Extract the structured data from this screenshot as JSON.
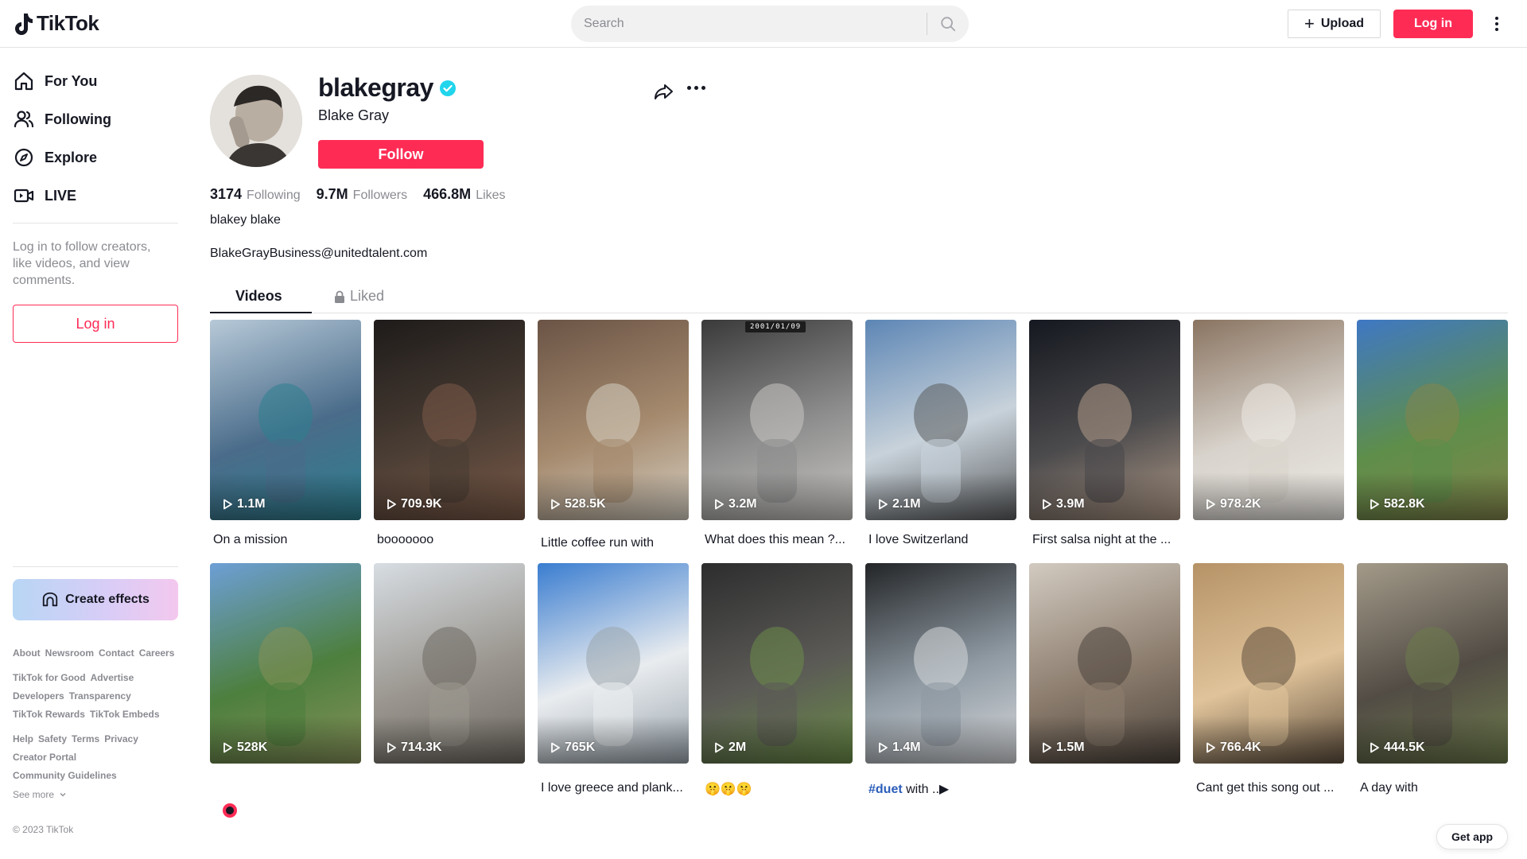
{
  "brand": {
    "name": "TikTok",
    "accent": "#fe2c55"
  },
  "header": {
    "search_placeholder": "Search",
    "upload_label": "Upload",
    "login_label": "Log in"
  },
  "sidebar": {
    "nav": [
      {
        "label": "For You",
        "icon": "home-icon"
      },
      {
        "label": "Following",
        "icon": "users-icon"
      },
      {
        "label": "Explore",
        "icon": "compass-icon"
      },
      {
        "label": "LIVE",
        "icon": "live-icon"
      }
    ],
    "note": "Log in to follow creators, like videos, and view comments.",
    "login_label": "Log in",
    "effects_label": "Create effects",
    "footer": [
      [
        "About",
        "Newsroom",
        "Contact",
        "Careers"
      ],
      [
        "TikTok for Good",
        "Advertise"
      ],
      [
        "Developers",
        "Transparency"
      ],
      [
        "TikTok Rewards",
        "TikTok Embeds"
      ],
      [
        "Help",
        "Safety",
        "Terms",
        "Privacy"
      ],
      [
        "Creator Portal"
      ],
      [
        "Community Guidelines"
      ]
    ],
    "see_more": "See more",
    "copyright": "© 2023 TikTok"
  },
  "profile": {
    "username": "blakegray",
    "display_name": "Blake Gray",
    "follow_label": "Follow",
    "stats": [
      {
        "value": "3174",
        "label": "Following"
      },
      {
        "value": "9.7M",
        "label": "Followers"
      },
      {
        "value": "466.8M",
        "label": "Likes"
      }
    ],
    "bio": "blakey blake",
    "email": "BlakeGrayBusiness@unitedtalent.com"
  },
  "tabs": {
    "videos": "Videos",
    "liked": "Liked"
  },
  "videos": [
    {
      "views": "1.1M",
      "caption": "On a mission",
      "colors": [
        "#b7c9d8",
        "#4a6c8a",
        "#2d7f8f"
      ]
    },
    {
      "views": "709.9K",
      "caption": "booooooo",
      "colors": [
        "#1e1b1a",
        "#4a3d34",
        "#7b5a48"
      ]
    },
    {
      "views": "528.5K",
      "caption": "Little coffee run with",
      "colors": [
        "#6b5446",
        "#a58a6e",
        "#d6cfc2"
      ]
    },
    {
      "views": "3.2M",
      "caption": "What does this mean ?...",
      "colors": [
        "#3a3a3a",
        "#8e8e8e",
        "#c9c7c3"
      ],
      "stamp": "2001/01/09"
    },
    {
      "views": "2.1M",
      "caption": "I love Switzerland",
      "colors": [
        "#5d86b5",
        "#c8d2da",
        "#5a5c5e"
      ]
    },
    {
      "views": "3.9M",
      "caption": "First salsa night at the ...",
      "colors": [
        "#151820",
        "#4b4a4c",
        "#b09a88"
      ]
    },
    {
      "views": "978.2K",
      "caption": "",
      "colors": [
        "#8a7461",
        "#d8d3cc",
        "#ece9e4"
      ]
    },
    {
      "views": "582.8K",
      "caption": "",
      "colors": [
        "#3f78c4",
        "#5e8e4a",
        "#83854c"
      ]
    },
    {
      "views": "528K",
      "caption": "",
      "colors": [
        "#6d9fd6",
        "#4d7f3e",
        "#86925a"
      ]
    },
    {
      "views": "714.3K",
      "caption": "",
      "colors": [
        "#d7dde3",
        "#9b9790",
        "#6e6a62"
      ]
    },
    {
      "views": "765K",
      "caption": "I love greece and plank...",
      "colors": [
        "#3a7dd0",
        "#e9ecef",
        "#9aa5ad"
      ]
    },
    {
      "views": "2M",
      "caption": "🤫🤫🤫",
      "colors": [
        "#2d2d2e",
        "#5b5a56",
        "#6b8d48"
      ]
    },
    {
      "views": "1.4M",
      "caption_tag": "#duet",
      "caption_rest": " with ..▶",
      "caption": "",
      "colors": [
        "#232527",
        "#8f9aa3",
        "#d6d8db"
      ]
    },
    {
      "views": "1.5M",
      "caption": "",
      "colors": [
        "#d2cac0",
        "#8c7d6e",
        "#4d443c"
      ]
    },
    {
      "views": "766.4K",
      "caption": "Cant get this song out ...",
      "colors": [
        "#b69367",
        "#e0c39a",
        "#5f4f3e"
      ]
    },
    {
      "views": "444.5K",
      "caption": "A day with",
      "colors": [
        "#a39a89",
        "#524c45",
        "#6e7c4d"
      ]
    }
  ],
  "get_app_label": "Get app"
}
